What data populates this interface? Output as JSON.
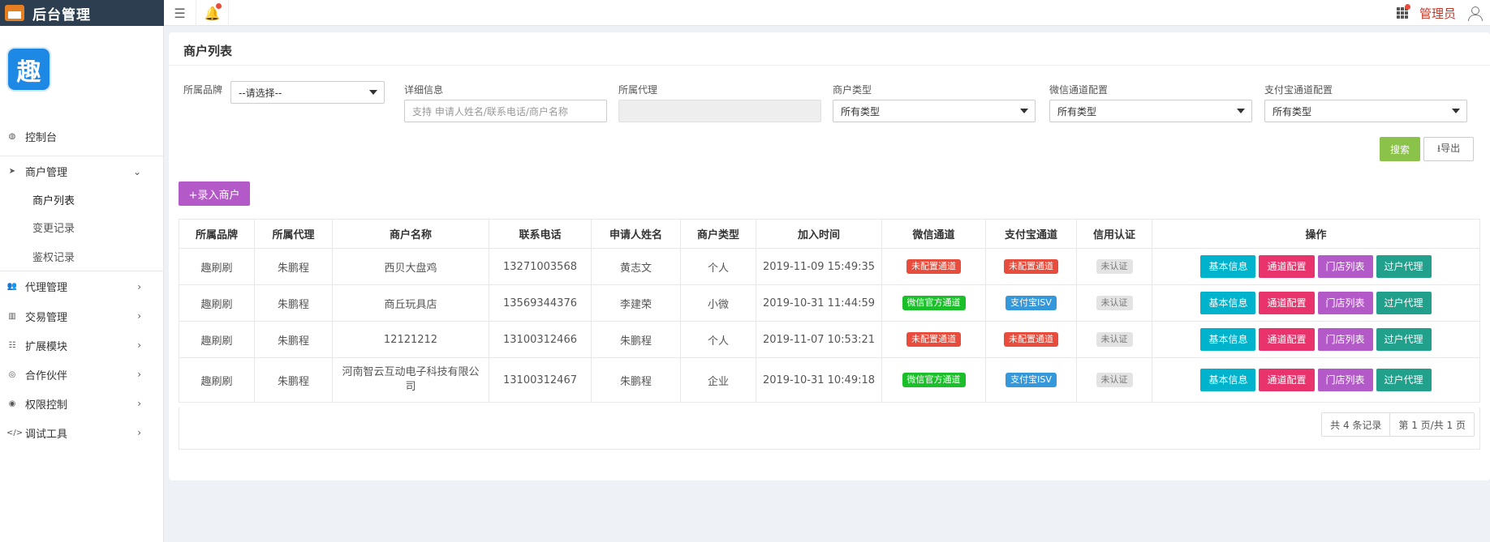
{
  "topbar": {
    "title": "后台管理",
    "admin_name": "管理员"
  },
  "sidebar": {
    "logo_text": "趣",
    "items": [
      {
        "label": "控制台",
        "icon": "dashboard-icon"
      },
      {
        "label": "商户管理",
        "icon": "paper-plane-icon"
      },
      {
        "label": "代理管理",
        "icon": "users-icon"
      },
      {
        "label": "交易管理",
        "icon": "bar-chart-icon"
      },
      {
        "label": "扩展模块",
        "icon": "list-icon"
      },
      {
        "label": "合作伙伴",
        "icon": "globe-icon"
      },
      {
        "label": "权限控制",
        "icon": "shield-icon"
      },
      {
        "label": "调试工具",
        "icon": "code-icon"
      }
    ],
    "subitems": [
      "商户列表",
      "变更记录",
      "鉴权记录"
    ]
  },
  "panel": {
    "title": "商户列表"
  },
  "filters": {
    "brand_label": "所属品牌",
    "brand_value": "--请选择--",
    "detail_label": "详细信息",
    "detail_placeholder": "支持 申请人姓名/联系电话/商户名称",
    "agent_label": "所属代理",
    "type_label": "商户类型",
    "type_value": "所有类型",
    "wx_label": "微信通道配置",
    "wx_value": "所有类型",
    "ali_label": "支付宝通道配置",
    "ali_value": "所有类型"
  },
  "buttons": {
    "search": "搜索",
    "export": "⭳导出",
    "add": "+录入商户"
  },
  "table": {
    "headers": [
      "所属品牌",
      "所属代理",
      "商户名称",
      "联系电话",
      "申请人姓名",
      "商户类型",
      "加入时间",
      "微信通道",
      "支付宝通道",
      "信用认证",
      "操作"
    ],
    "rows": [
      {
        "brand": "趣刷刷",
        "agent": "朱鹏程",
        "name": "西贝大盘鸡",
        "phone": "13271003568",
        "applicant": "黄志文",
        "type": "个人",
        "joined": "2019-11-09 15:49:35",
        "wx": "未配置通道",
        "ali": "未配置通道",
        "credit": "未认证"
      },
      {
        "brand": "趣刷刷",
        "agent": "朱鹏程",
        "name": "商丘玩具店",
        "phone": "13569344376",
        "applicant": "李建荣",
        "type": "小微",
        "joined": "2019-10-31 11:44:59",
        "wx": "微信官方通道",
        "ali": "支付宝ISV",
        "credit": "未认证"
      },
      {
        "brand": "趣刷刷",
        "agent": "朱鹏程",
        "name": "12121212",
        "phone": "13100312466",
        "applicant": "朱鹏程",
        "type": "个人",
        "joined": "2019-11-07 10:53:21",
        "wx": "未配置通道",
        "ali": "未配置通道",
        "credit": "未认证"
      },
      {
        "brand": "趣刷刷",
        "agent": "朱鹏程",
        "name": "河南智云互动电子科技有限公司",
        "phone": "13100312467",
        "applicant": "朱鹏程",
        "type": "企业",
        "joined": "2019-10-31 10:49:18",
        "wx": "微信官方通道",
        "ali": "支付宝ISV",
        "credit": "未认证"
      }
    ],
    "actions": [
      "基本信息",
      "通道配置",
      "门店列表",
      "过户代理"
    ]
  },
  "pager": {
    "total": "共 4 条记录",
    "page": "第 1 页/共 1 页"
  },
  "colors": {
    "sidebar_header": "#2c3e50",
    "search": "#8bc34a",
    "add": "#b45ac8",
    "op_info": "#00b3cc",
    "op_channel": "#e8336d",
    "op_store": "#b45ac8",
    "op_transfer": "#21a08c",
    "badge_unconfigured": "#e74c3c",
    "badge_wechat": "#1bbf2a",
    "badge_alipay": "#3498db"
  }
}
